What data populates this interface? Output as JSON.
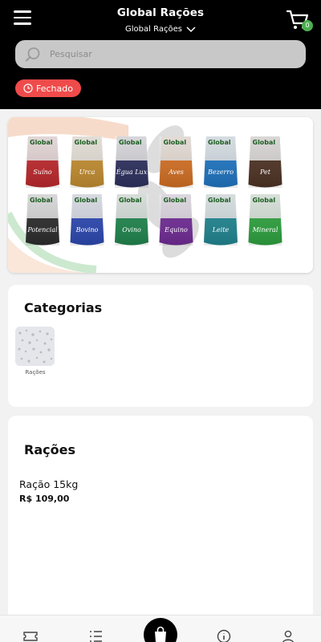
{
  "header": {
    "title": "Global Rações",
    "store_selector": "Global Rações",
    "cart_count": "0"
  },
  "search": {
    "placeholder": "Pesquisar"
  },
  "status": {
    "label": "Fechado",
    "color": "#f04b4b"
  },
  "categories": {
    "title": "Categorias",
    "items": [
      {
        "label": "Rações"
      }
    ]
  },
  "products_section": {
    "title": "Rações",
    "items": [
      {
        "name": "Ração 15kg",
        "price": "R$ 109,00"
      }
    ]
  },
  "banner": {
    "brand": "Global",
    "bags": [
      {
        "name": "Suíno",
        "color": "#b3262a"
      },
      {
        "name": "Urca",
        "color": "#b8862e"
      },
      {
        "name": "Égua Lux",
        "color": "#2b2e5a"
      },
      {
        "name": "Aves",
        "color": "#c86a22"
      },
      {
        "name": "Bezerro",
        "color": "#1e6fb8"
      },
      {
        "name": "Pet",
        "color": "#4a3022"
      },
      {
        "name": "Potencial",
        "color": "#2a2a2a"
      },
      {
        "name": "Bovino",
        "color": "#2a45a8"
      },
      {
        "name": "Ovino",
        "color": "#1f7f4a"
      },
      {
        "name": "Equino",
        "color": "#6b2a8e"
      },
      {
        "name": "Leite",
        "color": "#1f7f8a"
      },
      {
        "name": "Mineral",
        "color": "#2c9a3c"
      }
    ]
  },
  "nav": {
    "items": [
      "ticket-icon",
      "list-icon",
      "bag-icon",
      "info-icon",
      "user-icon"
    ]
  },
  "colors": {
    "accent": "#4caf50",
    "header_bg": "#000000",
    "closed": "#f04b4b"
  }
}
